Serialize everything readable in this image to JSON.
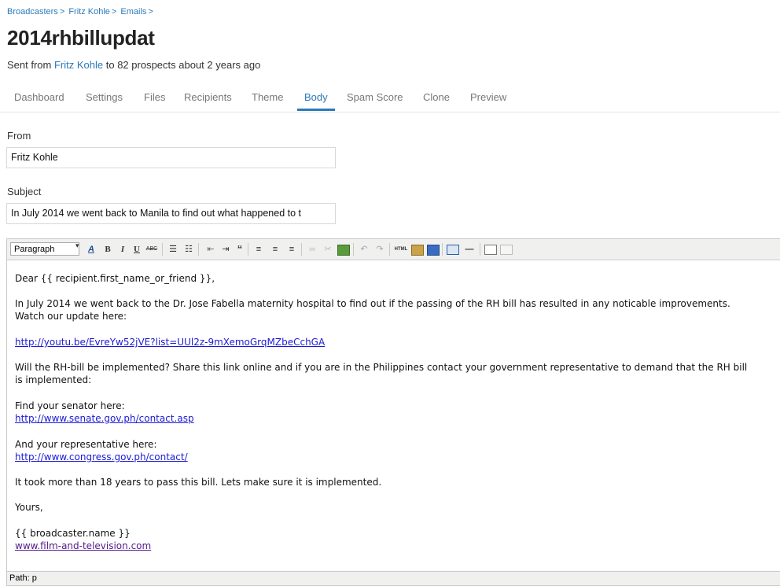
{
  "breadcrumb": {
    "items": [
      "Broadcasters",
      "Fritz Kohle",
      "Emails"
    ],
    "separator": ">"
  },
  "page_title": "2014rhbillupdat",
  "subline": {
    "prefix": "Sent from",
    "sender": "Fritz Kohle",
    "suffix": "to 82 prospects about 2 years ago"
  },
  "tabs": [
    {
      "label": "Dashboard"
    },
    {
      "label": "Settings"
    },
    {
      "label": "Files"
    },
    {
      "label": "Recipients"
    },
    {
      "label": "Theme"
    },
    {
      "label": "Body"
    },
    {
      "label": "Spam Score"
    },
    {
      "label": "Clone"
    },
    {
      "label": "Preview"
    }
  ],
  "active_tab": "Body",
  "from": {
    "label": "From",
    "value": "Fritz Kohle"
  },
  "subject": {
    "label": "Subject",
    "value": "In July 2014 we went back to Manila to find out what happened to t"
  },
  "editor": {
    "format_select": "Paragraph",
    "toolbar_icons": [
      "font-color-icon",
      "bold-icon",
      "italic-icon",
      "underline-icon",
      "strikethrough-icon",
      "bullet-list-icon",
      "numbered-list-icon",
      "outdent-icon",
      "indent-icon",
      "blockquote-icon",
      "align-left-icon",
      "align-center-icon",
      "align-right-icon",
      "link-icon",
      "unlink-icon",
      "image-icon",
      "undo-icon",
      "redo-icon",
      "html-source-icon",
      "paste-text-icon",
      "paste-word-icon",
      "table-icon",
      "horizontal-rule-icon",
      "edit-icon",
      "preview-icon"
    ],
    "body": {
      "greeting": "Dear {{ recipient.first_name_or_friend }},",
      "para1_line1": "In July 2014 we went back to the Dr. Jose Fabella maternity hospital to find out if the passing of the RH bill has resulted in any noticable improvements.",
      "para1_line2": "Watch our update here:",
      "youtube_link": "http://youtu.be/EvreYw52jVE?list=UUl2z-9mXemoGrqMZbeCchGA",
      "para2_line1": "Will the RH-bill be implemented? Share this link online and if you are in the Philippines contact your government representative to demand that the RH bill",
      "para2_line2": "is implemented:",
      "senator_text": "Find your senator here:",
      "senator_link": "http://www.senate.gov.ph/contact.asp",
      "rep_text": "And your representative here:",
      "rep_link": "http://www.congress.gov.ph/contact/",
      "closing_text": "It took more than 18 years to pass this bill. Lets make sure it is implemented.",
      "yours": "Yours,",
      "signature_name": "{{ broadcaster.name }}",
      "signature_link": "www.film-and-television.com"
    },
    "status_path": "Path: p"
  },
  "colors": {
    "link": "#2a7ab8",
    "active_tab": "#2a7ab8",
    "toolbar_bg": "#f0f0ee"
  }
}
